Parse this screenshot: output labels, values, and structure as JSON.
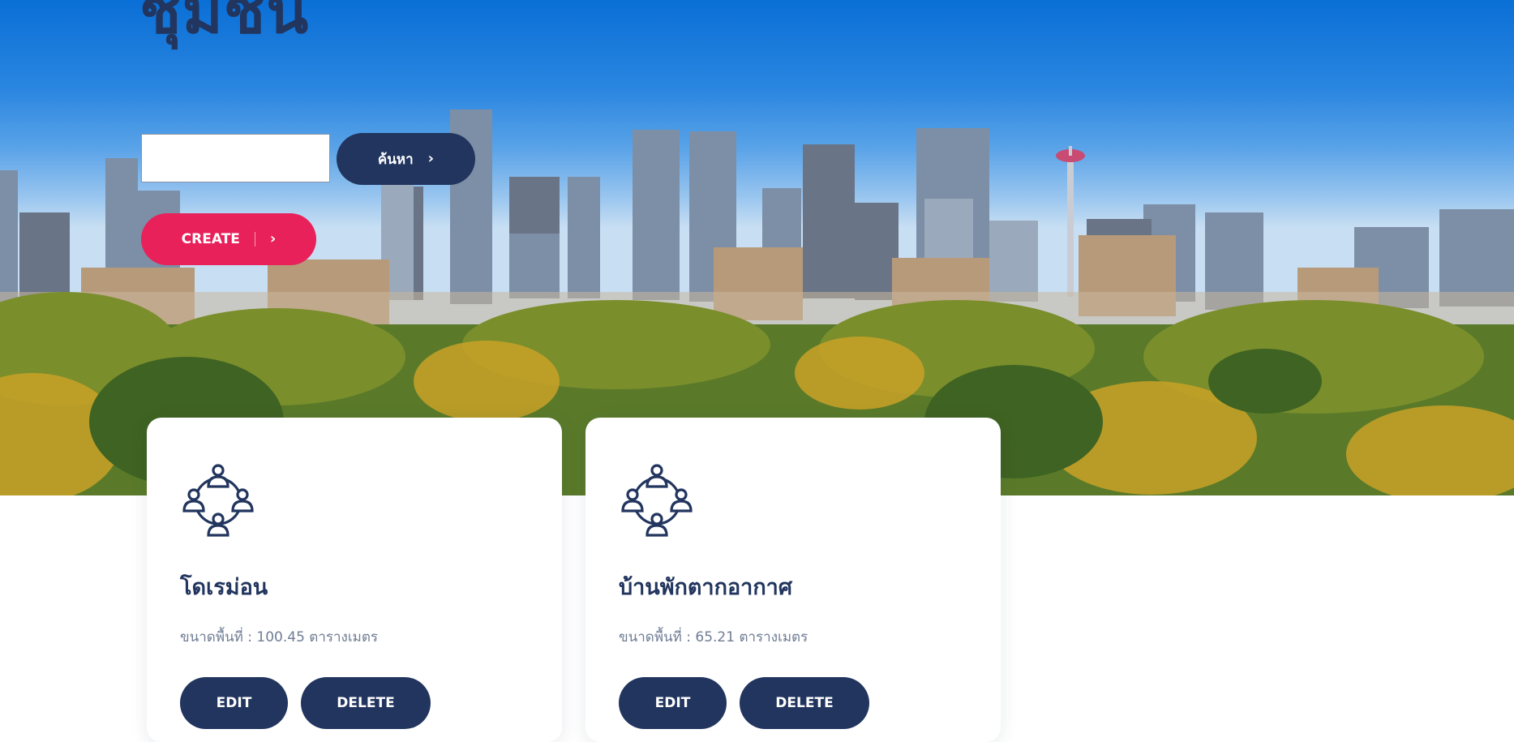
{
  "page": {
    "title": "ชุมชน"
  },
  "search": {
    "placeholder": "",
    "value": "",
    "button_label": "ค้นหา"
  },
  "create": {
    "button_label": "CREATE"
  },
  "colors": {
    "navy": "#22355e",
    "accent": "#e8215a",
    "muted_text": "#6f7d94"
  },
  "cards": [
    {
      "icon": "community-people-icon",
      "name": "โดเรม่อน",
      "area": "ขนาดพื้นที่ : 100.45 ตารางเมตร",
      "edit_label": "EDIT",
      "delete_label": "DELETE"
    },
    {
      "icon": "community-people-icon",
      "name": "บ้านพักตากอากาศ",
      "area": "ขนาดพื้นที่ : 65.21 ตารางเมตร",
      "edit_label": "EDIT",
      "delete_label": "DELETE"
    }
  ]
}
